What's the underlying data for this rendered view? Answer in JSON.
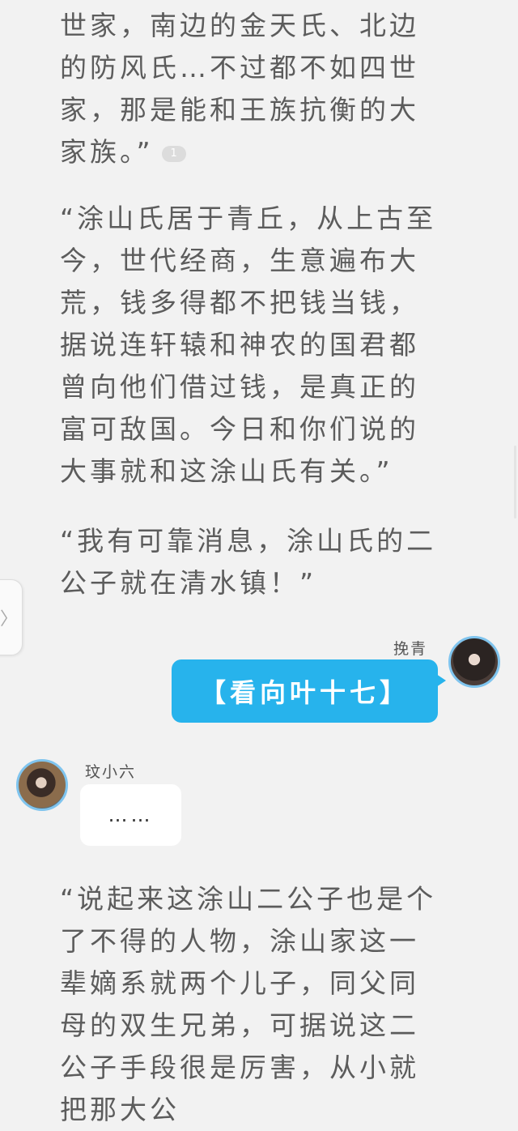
{
  "story": {
    "para1": "世家，南边的金天氏、北边的防风氏…不过都不如四世家，那是能和王族抗衡的大家族。”",
    "para1_comment_count": "1",
    "para2": "“涂山氏居于青丘，从上古至今，世代经商，生意遍布大荒，钱多得都不把钱当钱，据说连轩辕和神农的国君都曾向他们借过钱，是真正的富可敌国。今日和你们说的大事就和这涂山氏有关。”",
    "para3": "“我有可靠消息，涂山氏的二公子就在清水镇！”",
    "para4": "“说起来这涂山二公子也是个了不得的人物，涂山家这一辈嫡系就两个儿子，同父同母的双生兄弟，可据说这二公子手段很是厉害，从小就把那大公"
  },
  "chat": {
    "right_speaker": "挽青",
    "right_message": "【看向叶十七】",
    "left_speaker": "玟小六",
    "left_message": "……"
  },
  "ui": {
    "side_handle_glyph": "〉"
  }
}
